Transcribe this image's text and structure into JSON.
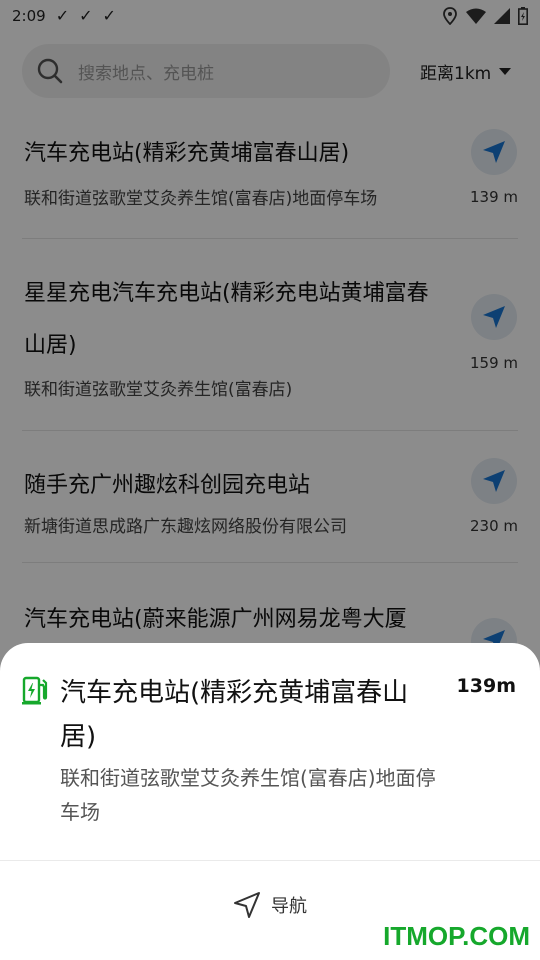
{
  "status_bar": {
    "time": "2:09",
    "notification_icons": [
      "check-icon",
      "check-icon",
      "check-icon"
    ],
    "system_icons": [
      "location-icon",
      "wifi-icon",
      "signal-icon",
      "battery-icon"
    ]
  },
  "search": {
    "placeholder": "搜索地点、充电桩",
    "distance_filter": "距离1km"
  },
  "stations": [
    {
      "title": "汽车充电站(精彩充黄埔富春山居)",
      "address": "联和街道弦歌堂艾灸养生馆(富春店)地面停车场",
      "distance": "139 m"
    },
    {
      "title": "星星充电汽车充电站(精彩充电站黄埔富春山居)",
      "address": "联和街道弦歌堂艾灸养生馆(富春店)",
      "distance": "159 m"
    },
    {
      "title": "随手充广州趣炫科创园充电站",
      "address": "新塘街道思成路广东趣炫网络股份有限公司",
      "distance": "230 m"
    },
    {
      "title": "汽车充电站(蔚来能源广州网易龙粤大厦",
      "address": "",
      "distance": ""
    }
  ],
  "detail_sheet": {
    "title": "汽车充电站(精彩充黄埔富春山居)",
    "distance": "139m",
    "address": "联和街道弦歌堂艾灸养生馆(富春店)地面停车场",
    "navigate_label": "导航"
  },
  "colors": {
    "accent_green": "#16a82c",
    "nav_blue": "#1976d2"
  },
  "watermark": "ITMOP.COM"
}
